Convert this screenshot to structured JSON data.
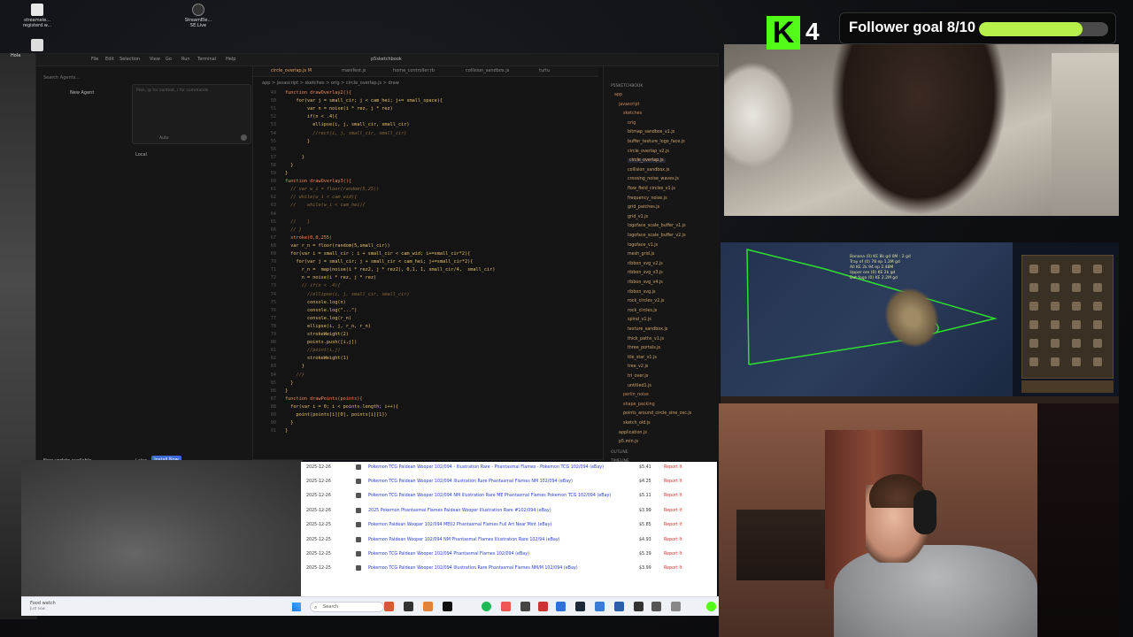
{
  "desktop": {
    "icons": [
      {
        "label_a": "streamele...",
        "label_b": "registerd.w..."
      },
      {
        "label_a": "StreamEle...",
        "label_b": "SE.Live"
      },
      {
        "label_a": "Hola",
        "label_b": ""
      }
    ]
  },
  "editor": {
    "menu": [
      "File",
      "Edit",
      "Selection",
      "View",
      "Go",
      "Run",
      "Terminal",
      "Help"
    ],
    "title": "p5sketchbook",
    "agent": {
      "search": "Search Agents...",
      "new_agent": "New Agent",
      "input_placeholder": "Plan, @ for context, / for commands",
      "mode": "Auto",
      "local": "Local",
      "update_text": "New update available",
      "update_later": "Later",
      "update_button": "Install Now"
    },
    "tabs": [
      {
        "label": "circle_overlap.js M",
        "active": true
      },
      {
        "label": "manifest.js",
        "active": false
      },
      {
        "label": "home_controller.rb",
        "active": false
      },
      {
        "label": "collision_sandbox.js",
        "active": false
      },
      {
        "label": "turtu",
        "active": false
      }
    ],
    "breadcrumb": "app > javascript > sketches > orig > circle_overlap.js > draw",
    "code": [
      {
        "n": "49",
        "t": "function drawOverlay2(){",
        "s": "k"
      },
      {
        "n": "50",
        "t": "    for(var j = small_cir; j < cam_hei; j+= small_space){",
        "s": ""
      },
      {
        "n": "51",
        "t": "        var n = noise(i * rez, j * rez)",
        "s": ""
      },
      {
        "n": "52",
        "t": "        if(n < .4){",
        "s": ""
      },
      {
        "n": "53",
        "t": "          ellipse(i, j, small_cir, small_cir)",
        "s": ""
      },
      {
        "n": "54",
        "t": "          //rect(i, j, small_cir, small_cir)",
        "s": "c"
      },
      {
        "n": "55",
        "t": "        }",
        "s": ""
      },
      {
        "n": "56",
        "t": "",
        "s": ""
      },
      {
        "n": "57",
        "t": "      }",
        "s": ""
      },
      {
        "n": "58",
        "t": "  }",
        "s": ""
      },
      {
        "n": "59",
        "t": "}",
        "s": ""
      },
      {
        "n": "60",
        "t": "function drawOverlay3(){",
        "s": "k"
      },
      {
        "n": "61",
        "t": "  // var w_i = floor(random(5,25))",
        "s": "c"
      },
      {
        "n": "62",
        "t": "  // while(w_i < cam_wid){",
        "s": "c"
      },
      {
        "n": "63",
        "t": "  //    while(w_i < cam_hei){",
        "s": "c"
      },
      {
        "n": "64",
        "t": "",
        "s": ""
      },
      {
        "n": "65",
        "t": "  //    }",
        "s": "c"
      },
      {
        "n": "66",
        "t": "  // }",
        "s": "c"
      },
      {
        "n": "67",
        "t": "  stroke(0,0,255)",
        "s": "k"
      },
      {
        "n": "68",
        "t": "  var r_n = floor(random(5,small_cir))",
        "s": ""
      },
      {
        "n": "69",
        "t": "  for(var i = small_cir ; i + small_cir < cam_wid; i+=small_cir*2){",
        "s": ""
      },
      {
        "n": "70",
        "t": "    for(var j = small_cir; j + small_cir < cam_hei; j+=small_cir*2){",
        "s": ""
      },
      {
        "n": "71",
        "t": "      r_n =  map(noise(i * rez2, j * rez2), 0,1, 1, small_cir/4,  small_cir)",
        "s": ""
      },
      {
        "n": "72",
        "t": "      n = noise(i * rez, j * rez)",
        "s": ""
      },
      {
        "n": "73",
        "t": "      // if(n < .4){",
        "s": "c"
      },
      {
        "n": "74",
        "t": "        //ellipse(i, j, small_cir, small_cir)",
        "s": "c"
      },
      {
        "n": "75",
        "t": "        console.log(n)",
        "s": ""
      },
      {
        "n": "76",
        "t": "        console.log(\"...\")",
        "s": ""
      },
      {
        "n": "77",
        "t": "        console.log(r_n)",
        "s": ""
      },
      {
        "n": "78",
        "t": "        ellipse(i, j, r_n, r_n)",
        "s": ""
      },
      {
        "n": "79",
        "t": "        strokeWeight(2)",
        "s": ""
      },
      {
        "n": "80",
        "t": "        points.push([i,j])",
        "s": ""
      },
      {
        "n": "81",
        "t": "        //point(i,j)",
        "s": "c"
      },
      {
        "n": "82",
        "t": "        strokeWeight(1)",
        "s": ""
      },
      {
        "n": "83",
        "t": "      }",
        "s": ""
      },
      {
        "n": "84",
        "t": "    //}",
        "s": "c"
      },
      {
        "n": "85",
        "t": "  }",
        "s": ""
      },
      {
        "n": "86",
        "t": "}",
        "s": ""
      },
      {
        "n": "87",
        "t": "function drawPoints(points){",
        "s": "k"
      },
      {
        "n": "88",
        "t": "  for(var i = 0; i < points.length; i++){",
        "s": ""
      },
      {
        "n": "89",
        "t": "    point(points[i][0], points[i][1])",
        "s": ""
      },
      {
        "n": "90",
        "t": "  }",
        "s": ""
      },
      {
        "n": "91",
        "t": "}",
        "s": ""
      }
    ],
    "explorer": {
      "header": "P5SKETCHBOOK",
      "items": [
        {
          "label": "app",
          "type": "folder",
          "indent": 0
        },
        {
          "label": "javascript",
          "type": "folder",
          "indent": 1
        },
        {
          "label": "sketches",
          "type": "folder",
          "indent": 2
        },
        {
          "label": "orig",
          "type": "folder",
          "indent": 3
        },
        {
          "label": "bitmap_sandbox_v1.js",
          "type": "file",
          "indent": 3
        },
        {
          "label": "buffer_texture_logo_face.js",
          "type": "file",
          "indent": 3
        },
        {
          "label": "circle_overlap_v2.js",
          "type": "file",
          "indent": 3
        },
        {
          "label": "circle_overlap.js",
          "type": "file",
          "indent": 3,
          "selected": true
        },
        {
          "label": "collision_sandbox.js",
          "type": "file",
          "indent": 3
        },
        {
          "label": "crossing_noise_waves.js",
          "type": "file",
          "indent": 3
        },
        {
          "label": "flow_field_circles_v1.js",
          "type": "file",
          "indent": 3
        },
        {
          "label": "frequency_noise.js",
          "type": "file",
          "indent": 3
        },
        {
          "label": "grid_patches.js",
          "type": "file",
          "indent": 3
        },
        {
          "label": "grid_v1.js",
          "type": "file",
          "indent": 3
        },
        {
          "label": "logoface_scale_buffer_v1.js",
          "type": "file",
          "indent": 3
        },
        {
          "label": "logoface_scale_buffer_v2.js",
          "type": "file",
          "indent": 3
        },
        {
          "label": "logoface_v1.js",
          "type": "file",
          "indent": 3
        },
        {
          "label": "mesh_grid.js",
          "type": "file",
          "indent": 3
        },
        {
          "label": "ribbon_svg_v2.js",
          "type": "file",
          "indent": 3
        },
        {
          "label": "ribbon_svg_v3.js",
          "type": "file",
          "indent": 3
        },
        {
          "label": "ribbon_svg_v4.js",
          "type": "file",
          "indent": 3
        },
        {
          "label": "ribbon_svg.js",
          "type": "file",
          "indent": 3
        },
        {
          "label": "rock_circles_v2.js",
          "type": "file",
          "indent": 3
        },
        {
          "label": "rock_circles.js",
          "type": "file",
          "indent": 3
        },
        {
          "label": "spiral_v1.js",
          "type": "file",
          "indent": 3
        },
        {
          "label": "texture_sandbox.js",
          "type": "file",
          "indent": 3
        },
        {
          "label": "thick_paths_v1.js",
          "type": "file",
          "indent": 3
        },
        {
          "label": "three_portals.js",
          "type": "file",
          "indent": 3
        },
        {
          "label": "tile_star_v1.js",
          "type": "file",
          "indent": 3
        },
        {
          "label": "tree_v2.js",
          "type": "file",
          "indent": 3
        },
        {
          "label": "tri_over.js",
          "type": "file",
          "indent": 3
        },
        {
          "label": "untitled1.js",
          "type": "file",
          "indent": 3
        },
        {
          "label": "perlin_noise",
          "type": "folder",
          "indent": 2
        },
        {
          "label": "shape_packing",
          "type": "folder",
          "indent": 2
        },
        {
          "label": "points_around_circle_sine_osc.js",
          "type": "file",
          "indent": 2
        },
        {
          "label": "sketch_old.js",
          "type": "file",
          "indent": 2
        },
        {
          "label": "application.js",
          "type": "file",
          "indent": 1
        },
        {
          "label": "p5.min.js",
          "type": "file",
          "indent": 1
        }
      ],
      "outline": "OUTLINE",
      "timeline": "TIMELINE"
    }
  },
  "sales": [
    {
      "date": "2025-12-26",
      "title": "Pokemon TCG Paldean Wooper 102/094 Illustration Rare Phantasmal Flames NM 102/094 (eBay)",
      "price": "$4.25",
      "report": "Report It"
    },
    {
      "date": "2025-12-26",
      "title": "Pokemon TCG Paldean Wooper 102/094 NM Illustration Rare ME Phantasmal Flames Pokemon TCG 102/094 (eBay)",
      "price": "$5.11",
      "report": "Report It"
    },
    {
      "date": "2025-12-26",
      "title": "2025 Pokemon Phantasmal Flames Paldean Wooper Illustration Rare #102/094 (eBay)",
      "price": "$3.99",
      "report": "Report It"
    },
    {
      "date": "2025-12-25",
      "title": "Pokemon Paldean Wooper 102/094 ME02 Phantasmal Flames Full Art Near Mint (eBay)",
      "price": "$5.85",
      "report": "Report It"
    },
    {
      "date": "2025-12-25",
      "title": "Pokemon Paldean Wooper 102/094 NM Phantasmal Flames Illustration Rare 102/94 (eBay)",
      "price": "$4.93",
      "report": "Report It"
    },
    {
      "date": "2025-12-25",
      "title": "Pokemon TCG Paldean Wooper 102/094 Phantasmal Flames 102/094 (eBay)",
      "price": "$5.39",
      "report": "Report It"
    },
    {
      "date": "2025-12-25",
      "title": "Pokemon TCG Paldean Wooper 102/094 Illustration Rare Phantasmal Flames NM/M 102/094 (eBay)",
      "price": "$3.99",
      "report": "Report It"
    }
  ],
  "sales_extra": [
    {
      "date": "2025-12-26",
      "title": "Pokemon TCG Paldean Wooper 102/094 - Illustration Rare - Phantasmal Flames - Pokemon TCG 102/094 (eBay)",
      "price": "$5.41",
      "report": "Report It"
    }
  ],
  "taskbar": {
    "notification_title": "Food watch",
    "notification_sub": "Just now",
    "search_label": "Search"
  },
  "stream": {
    "kick_count": "4",
    "goal_label": "Follower goal 8/10",
    "goal_progress": 0.8,
    "accent": "#53fc18",
    "bar_color": "#b7f04a"
  },
  "game_hud": "Banana (0) KE 8k gd 0M : 2 gd\nTray of (0) 78 ep 1.2M gd\nAll KE 2k 94 ep 2.48M\nUpper ore (0) KE 2k gd\nDet fogo (0) KE 2.2M gd"
}
